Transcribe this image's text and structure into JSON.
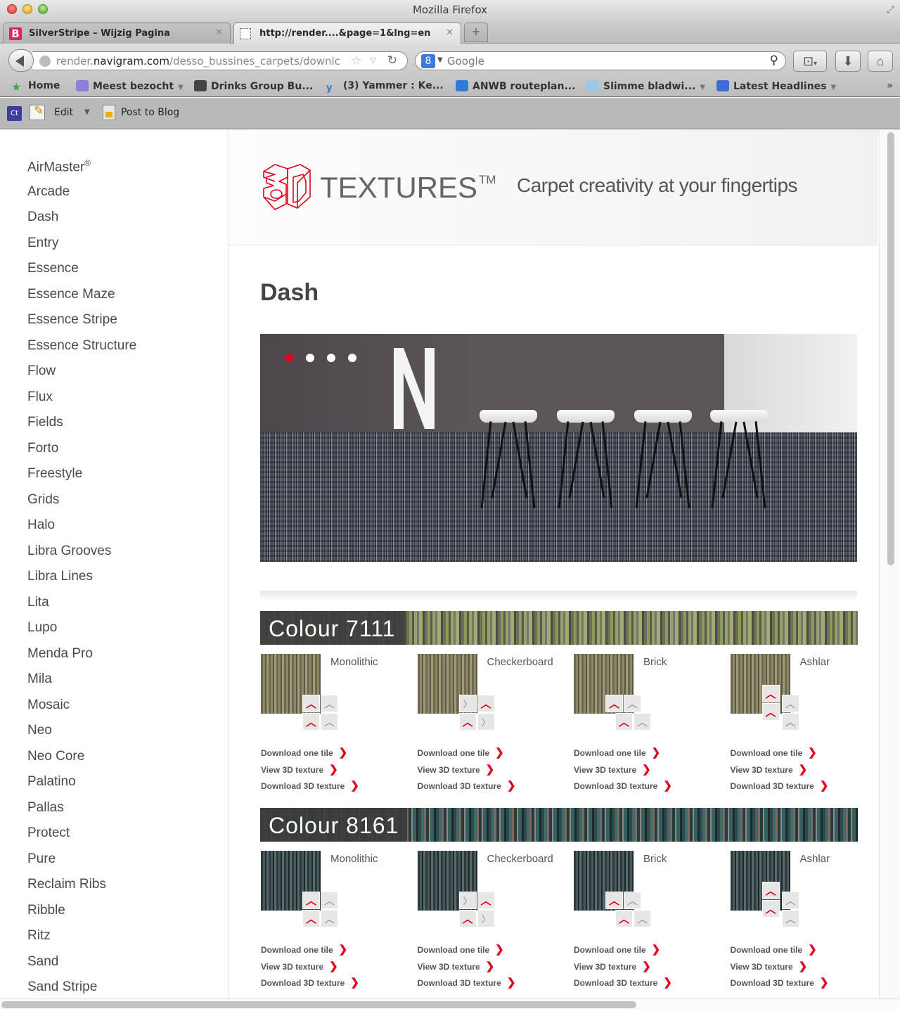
{
  "browser": {
    "window_title": "Mozilla Firefox",
    "tabs": [
      {
        "label": "SilverStripe – Wijzig Pagina",
        "favicon": "B",
        "active": false
      },
      {
        "label": "http://render....&page=1&lng=en",
        "active": true
      }
    ],
    "new_tab_label": "+",
    "url_prefix": "render.",
    "url_domain": "navigram.com",
    "url_path": "/desso_bussines_carpets/downlc",
    "search_engine_glyph": "8",
    "search_placeholder": "Google",
    "bookmarks": [
      {
        "label": "Home",
        "icon": "home-star-icon"
      },
      {
        "label": "Meest bezocht",
        "icon": "folder-icon",
        "dropdown": true
      },
      {
        "label": "Drinks Group Bu...",
        "icon": "123-icon"
      },
      {
        "label": "(3) Yammer : Ke...",
        "icon": "yammer-icon"
      },
      {
        "label": "ANWB routeplan...",
        "icon": "anwb-icon"
      },
      {
        "label": "Slimme bladwi...",
        "icon": "folder-icon",
        "dropdown": true
      },
      {
        "label": "Latest Headlines",
        "icon": "rss-icon",
        "dropdown": true
      }
    ],
    "bookmarks_more": "»",
    "addon_bar": {
      "ct_label": "Ct",
      "edit_label": "Edit",
      "post_label": "Post to Blog"
    }
  },
  "sidebar": {
    "items": [
      {
        "label": "AirMaster",
        "sup": "®"
      },
      {
        "label": "Arcade"
      },
      {
        "label": "Dash"
      },
      {
        "label": "Entry"
      },
      {
        "label": "Essence"
      },
      {
        "label": "Essence Maze"
      },
      {
        "label": "Essence Stripe"
      },
      {
        "label": "Essence Structure"
      },
      {
        "label": "Flow"
      },
      {
        "label": "Flux"
      },
      {
        "label": "Fields"
      },
      {
        "label": "Forto"
      },
      {
        "label": "Freestyle"
      },
      {
        "label": "Grids"
      },
      {
        "label": "Halo"
      },
      {
        "label": "Libra Grooves"
      },
      {
        "label": "Libra Lines"
      },
      {
        "label": "Lita"
      },
      {
        "label": "Lupo"
      },
      {
        "label": "Menda Pro"
      },
      {
        "label": "Mila"
      },
      {
        "label": "Mosaic"
      },
      {
        "label": "Neo"
      },
      {
        "label": "Neo Core"
      },
      {
        "label": "Palatino"
      },
      {
        "label": "Pallas"
      },
      {
        "label": "Protect"
      },
      {
        "label": "Pure"
      },
      {
        "label": "Reclaim Ribs"
      },
      {
        "label": "Ribble"
      },
      {
        "label": "Ritz"
      },
      {
        "label": "Sand"
      },
      {
        "label": "Sand Stripe"
      }
    ]
  },
  "header": {
    "logo_text": "TEXTURES",
    "logo_tm": "TM",
    "tagline": "Carpet creativity at your fingertips",
    "brand_color": "#e3001b"
  },
  "main": {
    "title": "Dash",
    "slider": {
      "slide_count": 4,
      "active_index": 0
    },
    "colours": [
      {
        "label": "Colour 7111",
        "patterns": [
          {
            "name": "Monolithic"
          },
          {
            "name": "Checkerboard"
          },
          {
            "name": "Brick"
          },
          {
            "name": "Ashlar"
          }
        ]
      },
      {
        "label": "Colour 8161",
        "patterns": [
          {
            "name": "Monolithic"
          },
          {
            "name": "Checkerboard"
          },
          {
            "name": "Brick"
          },
          {
            "name": "Ashlar"
          }
        ]
      }
    ],
    "links": {
      "download_tile": "Download one tile",
      "view_3d": "View 3D texture",
      "download_3d": "Download 3D texture"
    }
  }
}
